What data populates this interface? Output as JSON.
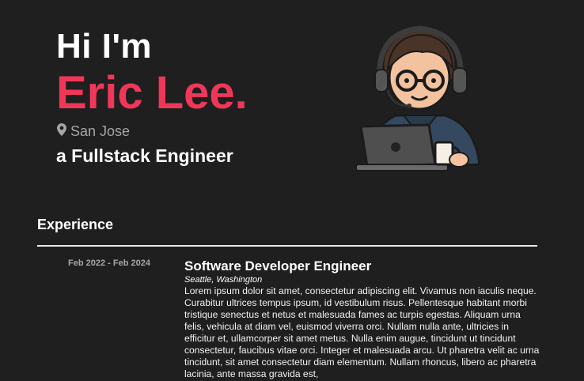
{
  "hero": {
    "greeting": "Hi I'm",
    "name": "Eric Lee.",
    "location": "San Jose",
    "role": "a Fullstack Engineer"
  },
  "avatar": {
    "icon": "developer-avatar-icon"
  },
  "experience": {
    "heading": "Experience",
    "items": [
      {
        "dates": "Feb 2022 - Feb 2024",
        "title": "Software Developer Engineer",
        "location": "Seattle, Washington",
        "description": "Lorem ipsum dolor sit amet, consectetur adipiscing elit. Vivamus non iaculis neque. Curabitur ultrices tempus ipsum, id vestibulum risus. Pellentesque habitant morbi tristique senectus et netus et malesuada fames ac turpis egestas. Aliquam urna felis, vehicula at diam vel, euismod viverra orci. Nullam nulla ante, ultricies in efficitur et, ullamcorper sit amet metus. Nulla enim augue, tincidunt ut tincidunt consectetur, faucibus vitae orci. Integer et malesuada arcu. Ut pharetra velit ac urna tincidunt, sit amet consectetur diam elementum. Nullam rhoncus, libero ac pharetra lacinia, ante massa gravida est,"
      }
    ]
  },
  "colors": {
    "background": "#1f1f1f",
    "accent": "#f0375a"
  }
}
